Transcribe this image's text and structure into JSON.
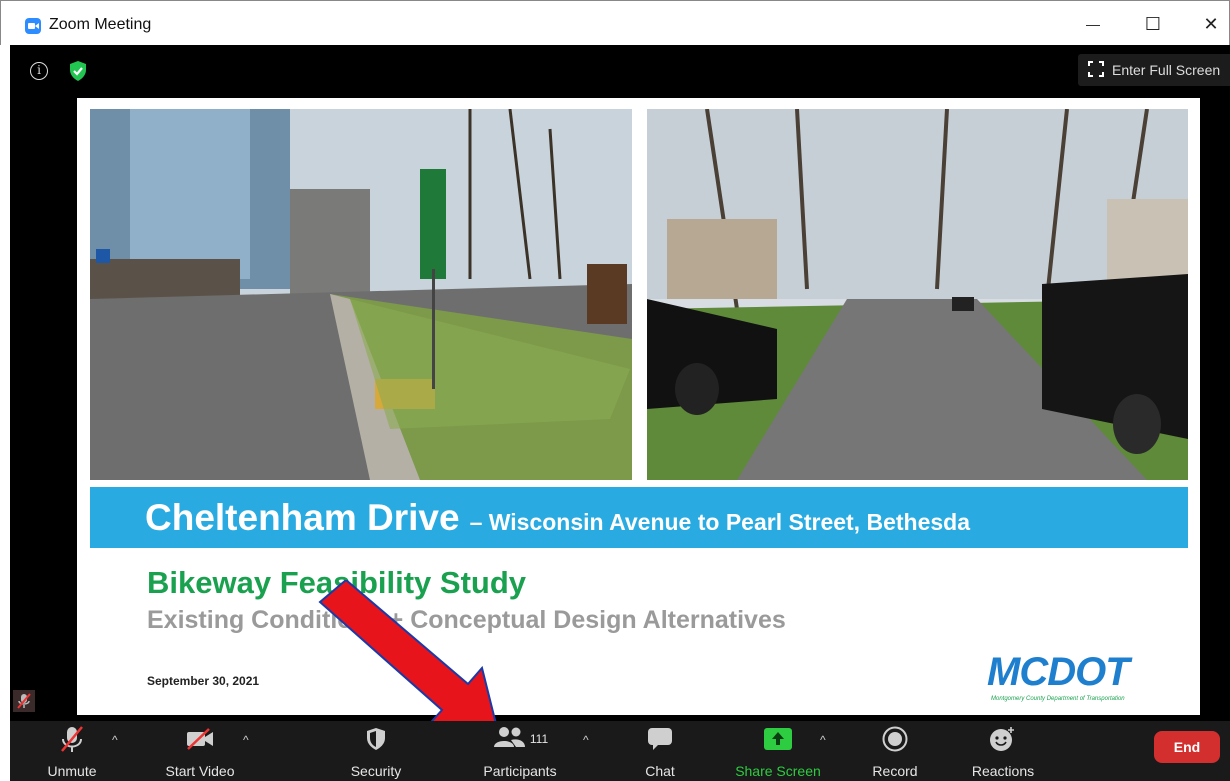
{
  "window": {
    "title": "Zoom Meeting",
    "minimize_glyph": "—",
    "maximize_glyph": "☐",
    "close_glyph": "✕"
  },
  "meeting": {
    "info_glyph": "i",
    "fullscreen_label": "Enter Full Screen"
  },
  "slide": {
    "banner_title": "Cheltenham Drive",
    "banner_subtitle": "– Wisconsin Avenue to Pearl Street, Bethesda",
    "study_title": "Bikeway Feasibility Study",
    "study_subtitle": "Existing Conditions + Conceptual Design Alternatives",
    "date": "September 30, 2021",
    "logo_text": "MCDOT",
    "logo_tagline": "Montgomery County Department of Transportation"
  },
  "toolbar": {
    "unmute_label": "Unmute",
    "start_video_label": "Start Video",
    "security_label": "Security",
    "participants_label": "Participants",
    "participants_count": "111",
    "chat_label": "Chat",
    "share_screen_label": "Share Screen",
    "record_label": "Record",
    "reactions_label": "Reactions",
    "end_label": "End",
    "caret_glyph": "^"
  },
  "colors": {
    "banner": "#29abe2",
    "study_title": "#1aa14f",
    "end_button": "#d42f2f",
    "share_screen": "#2ecc40",
    "annotation_arrow": "#e8141b"
  }
}
